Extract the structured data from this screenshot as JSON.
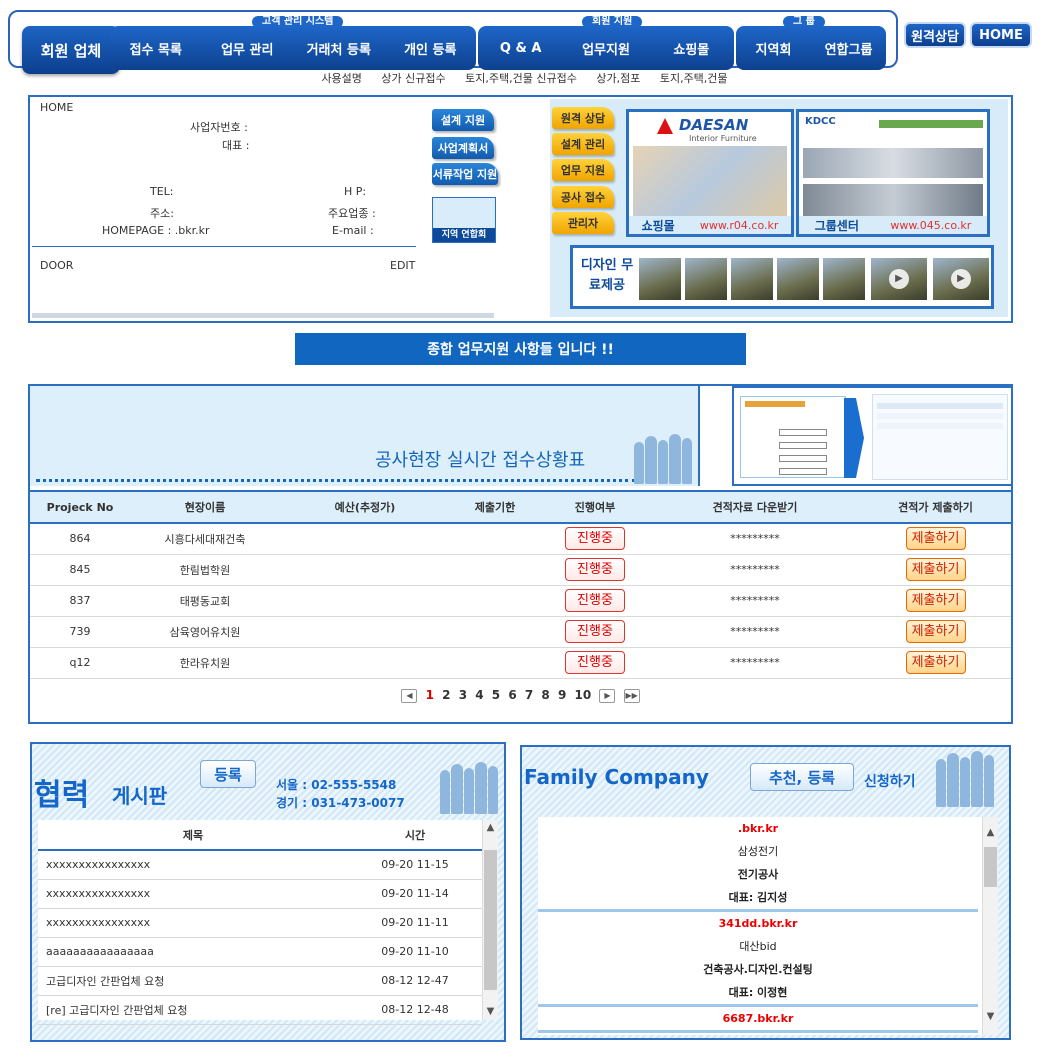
{
  "nav": {
    "brand": "회원 업체",
    "group1_tag": "고객 관리 시스템",
    "group1": [
      "접수 목록",
      "업무 관리",
      "거래처 등록",
      "개인 등록"
    ],
    "group2_tag": "회원 지원",
    "group2": [
      "Q & A",
      "업무지원",
      "쇼핑몰"
    ],
    "group3_tag": "그 룹",
    "group3": [
      "지역회",
      "연합그룹"
    ],
    "consult": "원격상담",
    "home": "HOME"
  },
  "subnav": [
    "사용설명",
    "상가 신규접수",
    "토지,주택,건물 신규접수",
    "상가,점포",
    "토지,주택,건물"
  ],
  "card": {
    "home": "HOME",
    "biz_no": "사업자번호 :",
    "ceo": "대표 :",
    "tel": "TEL:",
    "hp": "H P:",
    "address": "주소:",
    "main_item": "주요업종 :",
    "homepage": "HOMEPAGE : .bkr.kr",
    "email": "E-mail :",
    "door": "DOOR",
    "edit": "EDIT",
    "side_buttons": [
      "설계 지원",
      "사업계획서",
      "서류작업 지원"
    ],
    "map_label": "지역 연합회"
  },
  "promo": {
    "buttons": [
      "원격 상담",
      "설계 관리",
      "업무 지원",
      "공사 접수",
      "관리자"
    ],
    "shop_brand": "DAESAN",
    "shop_sub": "Interior Furniture",
    "shop_label": "쇼핑몰",
    "shop_url": "www.r04.co.kr",
    "group_brand": "KDCC",
    "group_label": "그룹센터",
    "group_url": "www.045.co.kr",
    "design_label": "디자인 무료제공"
  },
  "banner": "종합 업무지원 사항들 입니다 !!",
  "board": {
    "title": "공사현장 실시간 접수상황표",
    "columns": [
      "Projeck No",
      "현장이름",
      "예산(추정가)",
      "제출기한",
      "진행여부",
      "견적자료 다운받기",
      "견적가 제출하기"
    ],
    "rows": [
      {
        "no": "864",
        "name": "시흥다세대재건축",
        "budget": "",
        "deadline": "",
        "status": "진행중",
        "download": "*********",
        "submit": "제출하기"
      },
      {
        "no": "845",
        "name": "한림법학원",
        "budget": "",
        "deadline": "",
        "status": "진행중",
        "download": "*********",
        "submit": "제출하기"
      },
      {
        "no": "837",
        "name": "태평동교회",
        "budget": "",
        "deadline": "",
        "status": "진행중",
        "download": "*********",
        "submit": "제출하기"
      },
      {
        "no": "739",
        "name": "삼육영어유치원",
        "budget": "",
        "deadline": "",
        "status": "진행중",
        "download": "*********",
        "submit": "제출하기"
      },
      {
        "no": "q12",
        "name": "한라유치원",
        "budget": "",
        "deadline": "",
        "status": "진행중",
        "download": "*********",
        "submit": "제출하기"
      }
    ],
    "pages": [
      "1",
      "2",
      "3",
      "4",
      "5",
      "6",
      "7",
      "8",
      "9",
      "10"
    ],
    "current_page": "1"
  },
  "coop": {
    "title_big": "협력",
    "title_small": "게시판",
    "register": "등록",
    "phone1": "서울 : 02-555-5548",
    "phone2": "경기 : 031-473-0077",
    "col_title": "제목",
    "col_time": "시간",
    "posts": [
      {
        "title": "xxxxxxxxxxxxxxxx",
        "time": "09-20 11-15"
      },
      {
        "title": "xxxxxxxxxxxxxxxx",
        "time": "09-20 11-14"
      },
      {
        "title": "xxxxxxxxxxxxxxxx",
        "time": "09-20 11-11"
      },
      {
        "title": "aaaaaaaaaaaaaaaa",
        "time": "09-20 11-10"
      },
      {
        "title": " 고급디자인 간판업체 요청",
        "time": "08-12 12-47"
      },
      {
        "title": " [re]  고급디자인 간판업체 요청",
        "time": "08-12 12-48"
      }
    ]
  },
  "family": {
    "title": "Family Company",
    "register": "추천, 등록",
    "apply": "신청하기",
    "items": [
      {
        "domain": ".bkr.kr",
        "company": "삼성전기",
        "field": "전기공사",
        "ceo": "대표: 김지성"
      },
      {
        "domain": "341dd.bkr.kr",
        "company": "대산bid",
        "field": "건축공사.디자인.컨설팅",
        "ceo": "대표: 이정현"
      },
      {
        "domain": "6687.bkr.kr",
        "company": "",
        "field": "",
        "ceo": ""
      }
    ]
  },
  "colors": {
    "primary": "#1466c8",
    "dark": "#0d418f",
    "light_bg": "#dceffa",
    "accent_red": "#dd0000"
  }
}
